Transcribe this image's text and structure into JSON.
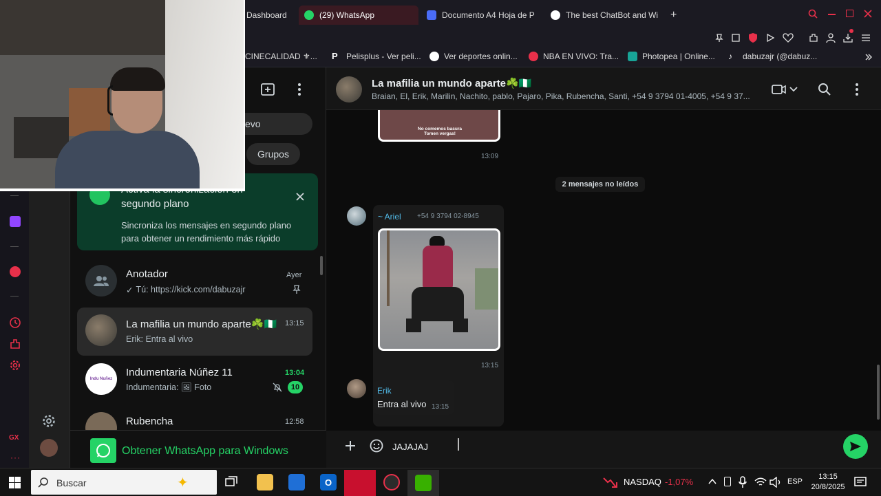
{
  "browser": {
    "tabs": [
      {
        "label": "Dashboard",
        "color": "#7c5cff"
      },
      {
        "label": "(29) WhatsApp",
        "color": "#25d366"
      },
      {
        "label": "Documento A4 Hoja de P",
        "color": "#4a6cf7"
      },
      {
        "label": "The best ChatBot and Wi",
        "color": "#ffffff"
      }
    ],
    "new_tab": "+",
    "bookmarks": [
      {
        "label": "CINECALIDAD ⚜...",
        "color": "#d9a520"
      },
      {
        "label": "Pelisplus - Ver peli...",
        "color": "#ffffff"
      },
      {
        "label": "Ver deportes onlin...",
        "color": "#ffffff"
      },
      {
        "label": "NBA EN VIVO: Tra...",
        "color": "#e8304a"
      },
      {
        "label": "Photopea | Online...",
        "color": "#18a497"
      },
      {
        "label": "dabuzajr (@dabuz...",
        "color": "#ffffff"
      }
    ]
  },
  "sidebar": {
    "filter_chip": "evo",
    "groups_chip": "Grupos",
    "banner": {
      "title_line1": "Activa la sincronización en",
      "title_line2": "segundo plano",
      "text_line1": "Sincroniza los mensajes en segundo plano",
      "text_line2": "para obtener un rendimiento más rápido"
    },
    "chats": [
      {
        "name": "Anotador",
        "time": "Ayer",
        "preview": "Tú: https://kick.com/dabuzajr"
      },
      {
        "name": "La mafilia un mundo aparte☘️🇳🇬",
        "time": "13:15",
        "preview": "Erik: Entra al vivo"
      },
      {
        "name": "Indumentaria Núñez 11",
        "time": "13:04",
        "preview": "Indumentaria: 🖼 Foto",
        "unread": "10",
        "avatar_text": "Indu Nuñez"
      },
      {
        "name": "Rubencha",
        "time": "12:58",
        "preview": ""
      }
    ],
    "get_app": "Obtener WhatsApp para Windows"
  },
  "chat": {
    "title": "La mafilia un mundo aparte☘️🇳🇬",
    "members": "Braian, El, Erik, Marilin, Nachito, pablo, Pajaro, Pika, Rubencha, Santi, +54 9 3794 01-4005, +54 9 37...",
    "img1_caption_line1": "No comemos basura",
    "img1_caption_line2": "Tomen vergas!",
    "time1": "13:09",
    "unread_divider": "2 mensajes no leídos",
    "msg2": {
      "sender": "~ Ariel",
      "phone": "+54 9 3794 02-8945",
      "time": "13:15"
    },
    "msg3": {
      "sender": "Erik",
      "text": "Entra al vivo",
      "time": "13:15"
    },
    "input_value": "JAJAJAJ"
  },
  "taskbar": {
    "search_placeholder": "Buscar",
    "ticker_name": "NASDAQ",
    "ticker_value": "-1,07%",
    "lang": "ESP",
    "time": "13:15",
    "date": "20/8/2025"
  },
  "colors": {
    "accent_green": "#25d366",
    "banner_bg": "#0b3d2a",
    "opera_red": "#e8304a",
    "sender_blue": "#53bdeb"
  }
}
